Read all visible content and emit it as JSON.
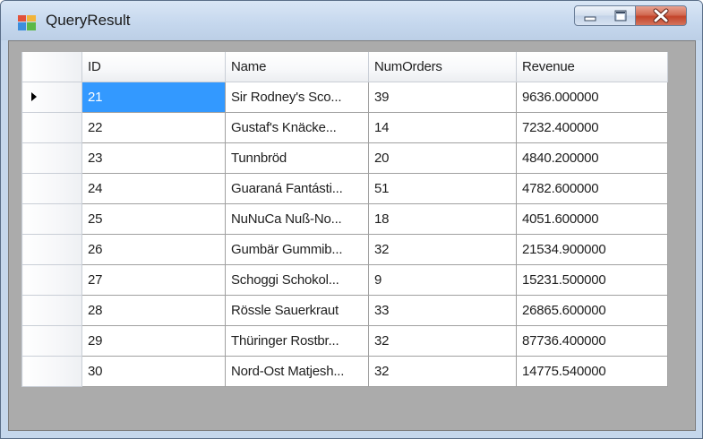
{
  "window": {
    "title": "QueryResult"
  },
  "grid": {
    "columns": [
      "ID",
      "Name",
      "NumOrders",
      "Revenue"
    ],
    "current_row": 0,
    "rows": [
      [
        "21",
        "Sir Rodney's Sco...",
        "39",
        "9636.000000"
      ],
      [
        "22",
        "Gustaf's Knäcke...",
        "14",
        "7232.400000"
      ],
      [
        "23",
        "Tunnbröd",
        "20",
        "4840.200000"
      ],
      [
        "24",
        "Guaraná Fantásti...",
        "51",
        "4782.600000"
      ],
      [
        "25",
        "NuNuCa Nuß-No...",
        "18",
        "4051.600000"
      ],
      [
        "26",
        "Gumbär Gummib...",
        "32",
        "21534.900000"
      ],
      [
        "27",
        "Schoggi Schokol...",
        "9",
        "15231.500000"
      ],
      [
        "28",
        "Rössle Sauerkraut",
        "33",
        "26865.600000"
      ],
      [
        "29",
        "Thüringer Rostbr...",
        "32",
        "87736.400000"
      ],
      [
        "30",
        "Nord-Ost Matjesh...",
        "32",
        "14775.540000"
      ]
    ]
  },
  "colors": {
    "selection": "#3399ff",
    "background": "#ababab"
  }
}
